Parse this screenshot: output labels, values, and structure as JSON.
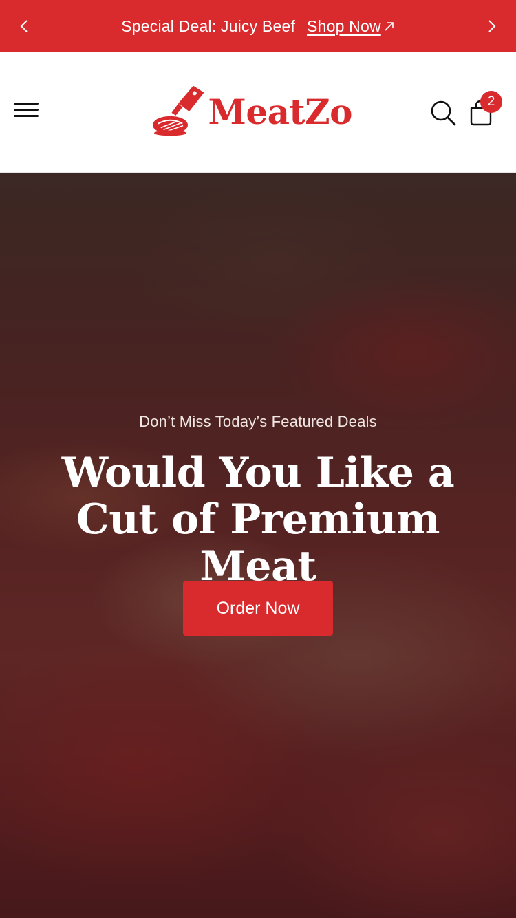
{
  "announcement": {
    "text": "Special Deal: Juicy Beef",
    "link_label": "Shop Now"
  },
  "header": {
    "brand": "MeatZo",
    "cart_count": "2"
  },
  "hero": {
    "subtitle": "Don’t Miss Today’s Featured Deals",
    "title": "Would You Like a Cut of Premium Meat",
    "cta_label": "Order Now"
  },
  "colors": {
    "brand_red": "#d92b2e",
    "header_bg": "#ffffff",
    "hero_text": "#ffffff"
  },
  "icons": {
    "prev": "chevron-left-icon",
    "next": "chevron-right-icon",
    "external": "arrow-up-right-icon",
    "menu": "hamburger-menu-icon",
    "search": "search-icon",
    "cart": "shopping-bag-icon",
    "logo": "cleaver-steak-icon"
  }
}
